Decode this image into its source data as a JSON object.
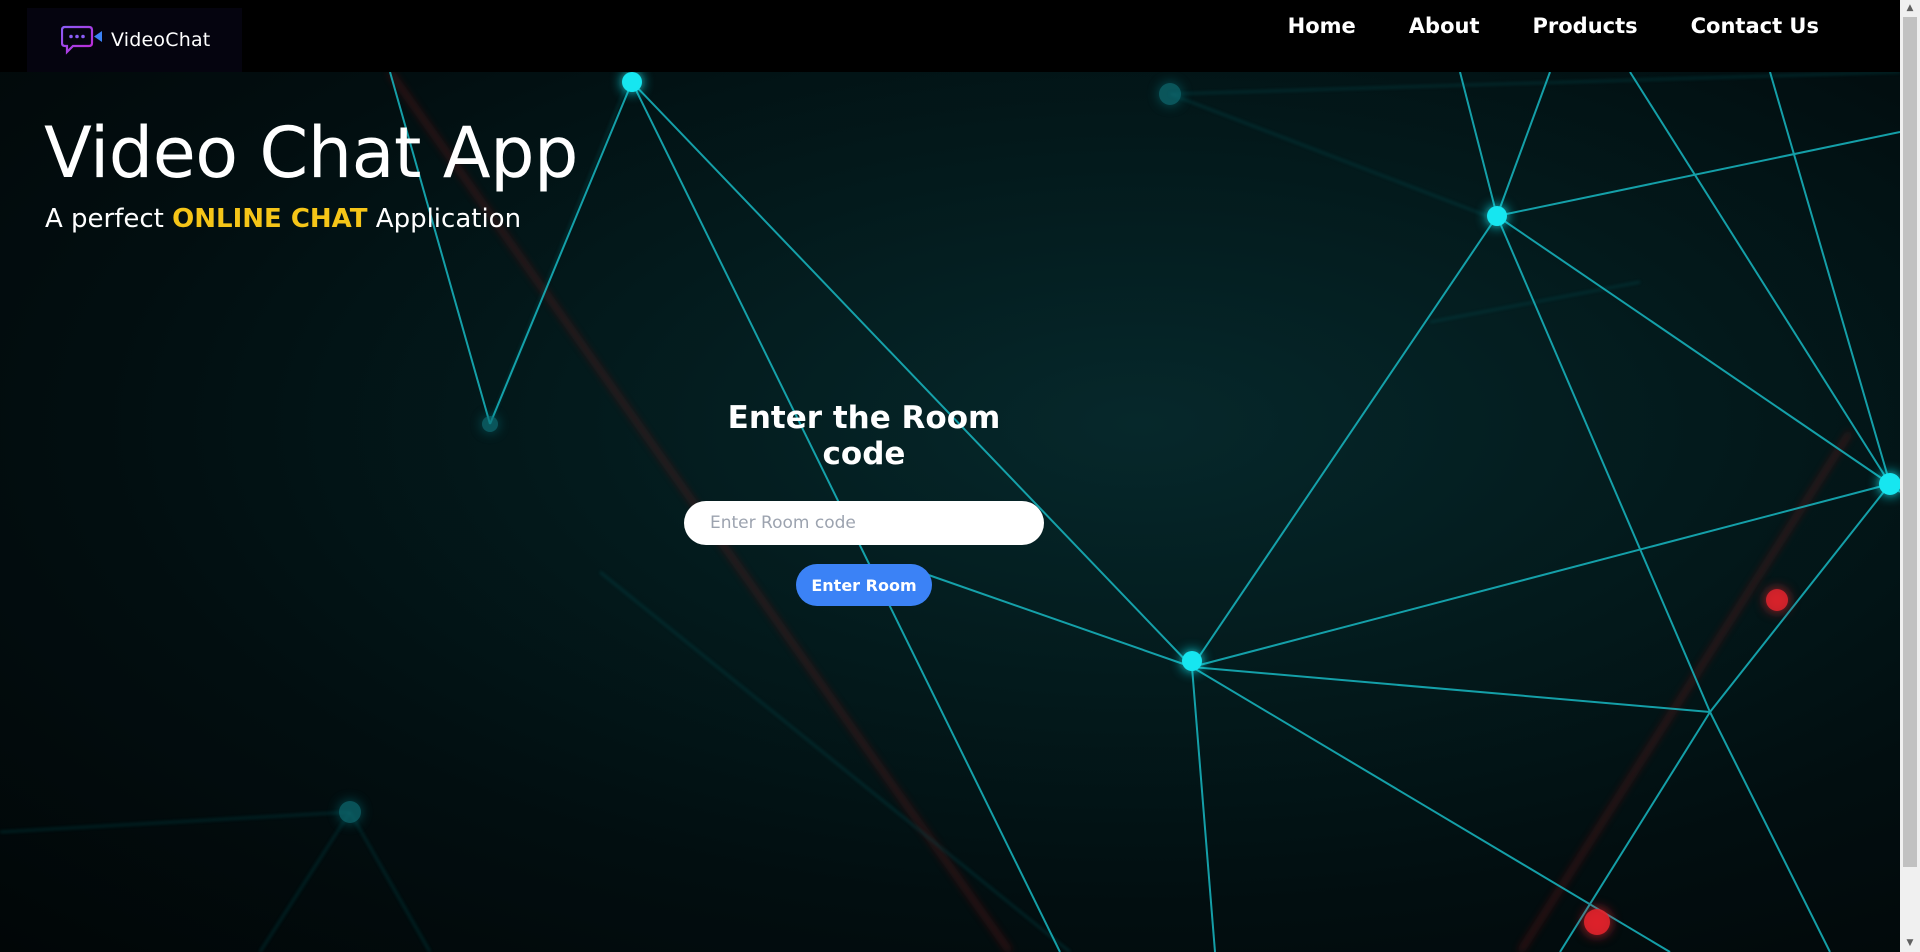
{
  "navbar": {
    "logo_text": "VideoChat",
    "logo_icon": "chat-bubble-video-icon",
    "links": [
      "Home",
      "About",
      "Products",
      "Contact Us"
    ]
  },
  "hero": {
    "title": "Video Chat App",
    "subtitle_prefix": "A perfect ",
    "subtitle_highlight": "ONLINE CHAT",
    "subtitle_suffix": " Application"
  },
  "room": {
    "heading": "Enter the Room code",
    "input_placeholder": "Enter Room code",
    "input_value": "",
    "button_label": "Enter Room"
  },
  "colors": {
    "accent_button": "#3b82f6",
    "highlight_text": "#f5c518",
    "node_cyan": "#14e6f0",
    "node_red": "#e0242c"
  }
}
